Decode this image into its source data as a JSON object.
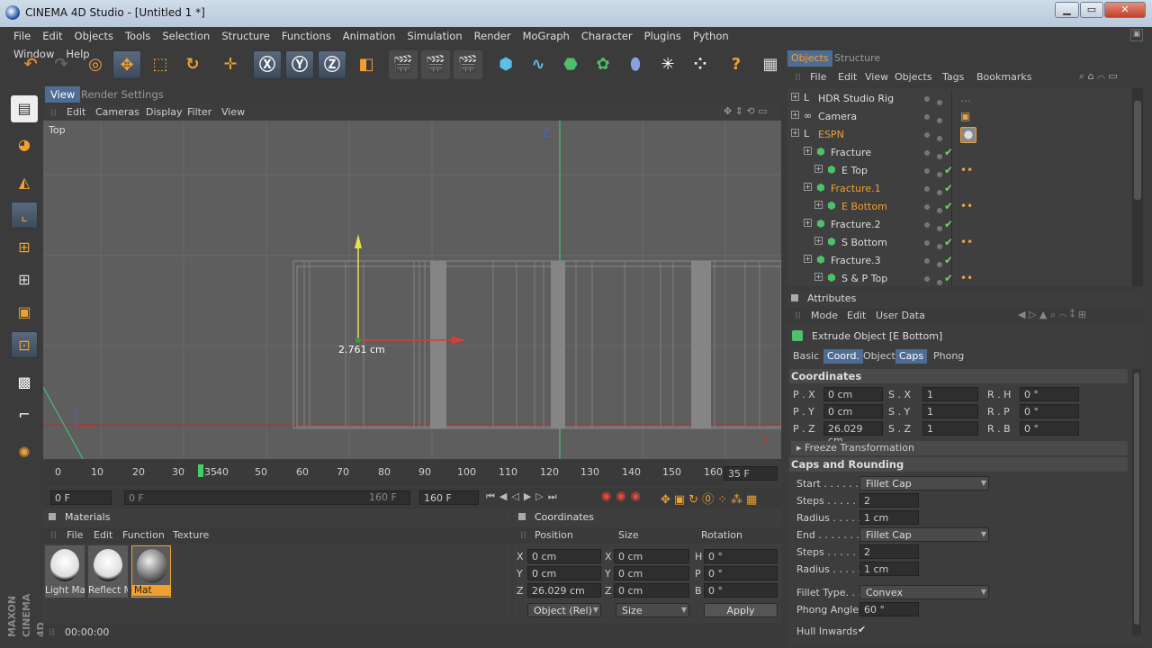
{
  "window": {
    "title": "CINEMA 4D Studio - [Untitled 1 *]"
  },
  "menu": [
    "File",
    "Edit",
    "Objects",
    "Tools",
    "Selection",
    "Structure",
    "Functions",
    "Animation",
    "Simulation",
    "Render",
    "MoGraph",
    "Character",
    "Plugins",
    "Python",
    "Window",
    "Help"
  ],
  "viewport": {
    "tabs": [
      "View",
      "Render Settings"
    ],
    "menu": [
      "Edit",
      "Cameras",
      "Display",
      "Filter",
      "View"
    ],
    "label": "Top",
    "measure": "2.761 cm",
    "axis_z": "Z",
    "axis_x": "X"
  },
  "timeline": {
    "ticks": [
      "0",
      "10",
      "20",
      "30",
      "35",
      "40",
      "50",
      "60",
      "70",
      "80",
      "90",
      "100",
      "110",
      "120",
      "130",
      "140",
      "150",
      "160"
    ],
    "current_frame": "35 F",
    "start_field": "0 F",
    "range_start": "0 F",
    "range_end": "160 F",
    "end_field": "160 F"
  },
  "materials": {
    "title": "Materials",
    "menu": [
      "File",
      "Edit",
      "Function",
      "Texture"
    ],
    "items": [
      {
        "name": "Light Ma"
      },
      {
        "name": "Reflect M"
      },
      {
        "name": "Mat"
      }
    ]
  },
  "coordinates": {
    "title": "Coordinates",
    "headers": [
      "Position",
      "Size",
      "Rotation"
    ],
    "rows": [
      {
        "a": "X",
        "pos": "0 cm",
        "b": "X",
        "size": "0 cm",
        "c": "H",
        "rot": "0 °"
      },
      {
        "a": "Y",
        "pos": "0 cm",
        "b": "Y",
        "size": "0 cm",
        "c": "P",
        "rot": "0 °"
      },
      {
        "a": "Z",
        "pos": "26.029 cm",
        "b": "Z",
        "size": "0 cm",
        "c": "B",
        "rot": "0 °"
      }
    ],
    "mode": "Object (Rel)",
    "size_mode": "Size",
    "apply": "Apply"
  },
  "status": {
    "time": "00:00:00"
  },
  "branding": "MAXON CINEMA 4D",
  "objects": {
    "tabs": [
      "Objects",
      "Structure"
    ],
    "menu": [
      "File",
      "Edit",
      "View",
      "Objects",
      "Tags",
      "Bookmarks"
    ],
    "rows": [
      {
        "name": "HDR Studio Rig",
        "indent": 0,
        "check": false,
        "tag": "…"
      },
      {
        "name": "Camera",
        "indent": 0,
        "check": false,
        "tag": "▣"
      },
      {
        "name": "ESPN",
        "indent": 0,
        "check": false,
        "tag": "●",
        "orange": true
      },
      {
        "name": "Fracture",
        "indent": 1,
        "check": true,
        "tag": ""
      },
      {
        "name": "E Top",
        "indent": 2,
        "check": true,
        "tag": "••"
      },
      {
        "name": "Fracture.1",
        "indent": 1,
        "check": true,
        "tag": "",
        "orange": true
      },
      {
        "name": "E Bottom",
        "indent": 2,
        "check": true,
        "tag": "••",
        "orange": true
      },
      {
        "name": "Fracture.2",
        "indent": 1,
        "check": true,
        "tag": ""
      },
      {
        "name": "S Bottom",
        "indent": 2,
        "check": true,
        "tag": "••"
      },
      {
        "name": "Fracture.3",
        "indent": 1,
        "check": true,
        "tag": ""
      },
      {
        "name": "S & P Top",
        "indent": 2,
        "check": true,
        "tag": "••"
      }
    ]
  },
  "attributes": {
    "title": "Attributes",
    "menu": [
      "Mode",
      "Edit",
      "User Data"
    ],
    "object_title": "Extrude Object [E Bottom]",
    "tabs": [
      "Basic",
      "Coord.",
      "Object",
      "Caps",
      "Phong"
    ],
    "coord_section": "Coordinates",
    "coord_rows": [
      {
        "l1": "P . X",
        "v1": "0 cm",
        "l2": "S . X",
        "v2": "1",
        "l3": "R . H",
        "v3": "0 °"
      },
      {
        "l1": "P . Y",
        "v1": "0 cm",
        "l2": "S . Y",
        "v2": "1",
        "l3": "R . P",
        "v3": "0 °"
      },
      {
        "l1": "P . Z",
        "v1": "26.029 cm",
        "l2": "S . Z",
        "v2": "1",
        "l3": "R . B",
        "v3": "0 °"
      }
    ],
    "freeze": "Freeze Transformation",
    "caps_section": "Caps and Rounding",
    "caps_rows": [
      {
        "label": "Start . . . . . .",
        "value": "Fillet Cap",
        "type": "drop"
      },
      {
        "label": "Steps . . . . .",
        "value": "2",
        "type": "num"
      },
      {
        "label": "Radius . . . . .",
        "value": "1 cm",
        "type": "num"
      },
      {
        "label": "End . . . . . . .",
        "value": "Fillet Cap",
        "type": "drop"
      },
      {
        "label": "Steps . . . . .",
        "value": "2",
        "type": "num"
      },
      {
        "label": "Radius . . . . .",
        "value": "1 cm",
        "type": "num"
      }
    ],
    "fillet_type_label": "Fillet Type. . .",
    "fillet_type": "Convex",
    "phong_label": "Phong Angle",
    "phong_value": "60 °",
    "hull_label": "Hull Inwards",
    "hull_value": "✔"
  },
  "colors": {
    "accent": "#f0a030",
    "selected_tab": "#4f6d94"
  }
}
